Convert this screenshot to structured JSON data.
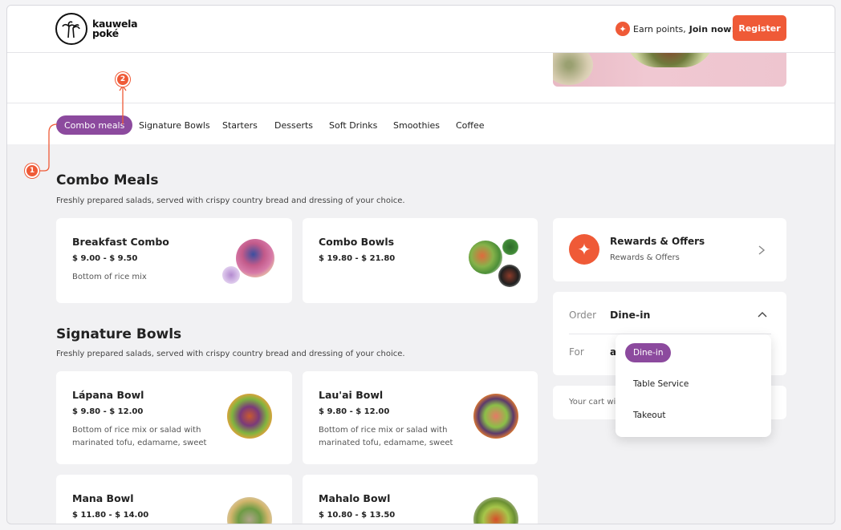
{
  "header": {
    "logo_line1": "kauwela",
    "logo_line2": "poké",
    "earn_text": "Earn points,",
    "earn_cta": "Join now!",
    "register_label": "Register"
  },
  "tabs": [
    {
      "label": "Combo meals"
    },
    {
      "label": "Signature Bowls"
    },
    {
      "label": "Starters"
    },
    {
      "label": "Desserts"
    },
    {
      "label": "Soft Drinks"
    },
    {
      "label": "Smoothies"
    },
    {
      "label": "Coffee"
    }
  ],
  "annotations": {
    "badge1": "1",
    "badge2": "2"
  },
  "combo": {
    "title": "Combo Meals",
    "subtitle": "Freshly prepared salads, served with crispy country bread and dressing of your choice.",
    "items": [
      {
        "name": "Breakfast Combo",
        "price": "$ 9.00 - $ 9.50",
        "desc": "Bottom of rice mix"
      },
      {
        "name": "Combo Bowls",
        "price": "$ 19.80 - $ 21.80",
        "desc": ""
      }
    ]
  },
  "signature": {
    "title": "Signature Bowls",
    "subtitle": "Freshly prepared salads, served with crispy country bread and dressing of your choice.",
    "items": [
      {
        "name": "Lápana Bowl",
        "price": "$ 9.80 - $ 12.00",
        "desc": "Bottom of rice mix or salad with marinated tofu, edamame, sweet"
      },
      {
        "name": "Lau'ai Bowl",
        "price": "$ 9.80 - $ 12.00",
        "desc": "Bottom of rice mix or salad with marinated tofu, edamame, sweet"
      },
      {
        "name": "Mana Bowl",
        "price": "$ 11.80 - $ 14.00",
        "desc": ""
      },
      {
        "name": "Mahalo Bowl",
        "price": "$ 10.80 - $ 13.50",
        "desc": ""
      }
    ]
  },
  "rewards": {
    "title": "Rewards & Offers",
    "subtitle": "Rewards & Offers"
  },
  "order": {
    "label": "Order",
    "value": "Dine-in",
    "for_label": "For",
    "for_value": "a",
    "cart_text": "Your cart wi",
    "options": [
      "Dine-in",
      "Table Service",
      "Takeout"
    ]
  },
  "colors": {
    "accent": "#ef5a37",
    "purple": "#8c4a9e"
  }
}
